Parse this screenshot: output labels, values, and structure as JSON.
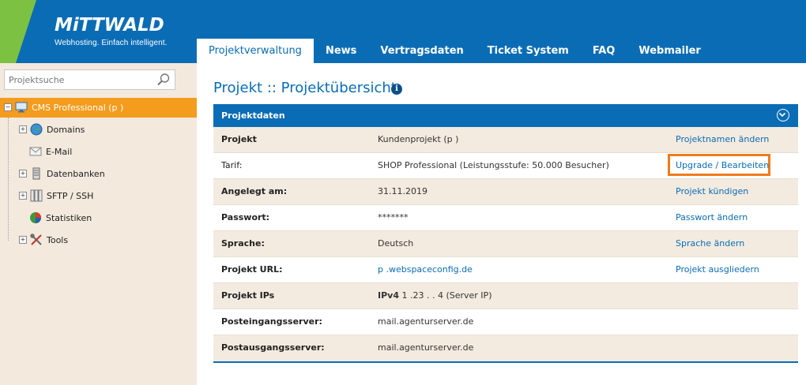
{
  "header": {
    "logo": "MiTTWALD",
    "tagline": "Webhosting. Einfach intelligent.",
    "colors": {
      "brand_blue": "#0a6cb5",
      "brand_green": "#7dc142",
      "accent_orange": "#f39c1e"
    }
  },
  "nav": {
    "tabs": [
      {
        "label": "Projektverwaltung",
        "active": true
      },
      {
        "label": "News",
        "active": false
      },
      {
        "label": "Vertragsdaten",
        "active": false
      },
      {
        "label": "Ticket System",
        "active": false
      },
      {
        "label": "FAQ",
        "active": false
      },
      {
        "label": "Webmailer",
        "active": false
      }
    ]
  },
  "sidebar": {
    "search_placeholder": "Projektsuche",
    "project": {
      "label": "CMS Professional (p            )",
      "expander": "−"
    },
    "items": [
      {
        "label": "Domains",
        "icon": "globe-icon",
        "expandable": true
      },
      {
        "label": "E-Mail",
        "icon": "envelope-icon",
        "expandable": false
      },
      {
        "label": "Datenbanken",
        "icon": "database-icon",
        "expandable": true
      },
      {
        "label": "SFTP / SSH",
        "icon": "folder-server-icon",
        "expandable": true
      },
      {
        "label": "Statistiken",
        "icon": "pie-chart-icon",
        "expandable": false
      },
      {
        "label": "Tools",
        "icon": "tools-icon",
        "expandable": true
      }
    ]
  },
  "main": {
    "title": "Projekt :: Projektübersicht",
    "panel_title": "Projektdaten",
    "rows": [
      {
        "label": "Projekt",
        "value": "Kundenprojekt (p            )",
        "action": "Projektnamen ändern"
      },
      {
        "label": "Tarif:",
        "value": "SHOP Professional (Leistungsstufe: 50.000 Besucher)",
        "action": "Upgrade / Bearbeiten",
        "highlight": true
      },
      {
        "label": "Angelegt am:",
        "value": "31.11.2019",
        "action": "Projekt kündigen"
      },
      {
        "label": "Passwort:",
        "value": "*******",
        "action": "Passwort ändern"
      },
      {
        "label": "Sprache:",
        "value": "Deutsch",
        "action": "Sprache ändern"
      },
      {
        "label": "Projekt URL:",
        "value": "p            .webspaceconfig.de",
        "action": "Projekt ausgliedern",
        "value_link": true
      },
      {
        "label": "Projekt IPs",
        "value_prefix": "IPv4",
        "value": "1      .23    .      .    4 (Server IP)",
        "action": ""
      },
      {
        "label": "Posteingangsserver:",
        "value": "mail.agenturserver.de",
        "action": ""
      },
      {
        "label": "Postausgangsserver:",
        "value": "mail.agenturserver.de",
        "action": ""
      }
    ]
  }
}
